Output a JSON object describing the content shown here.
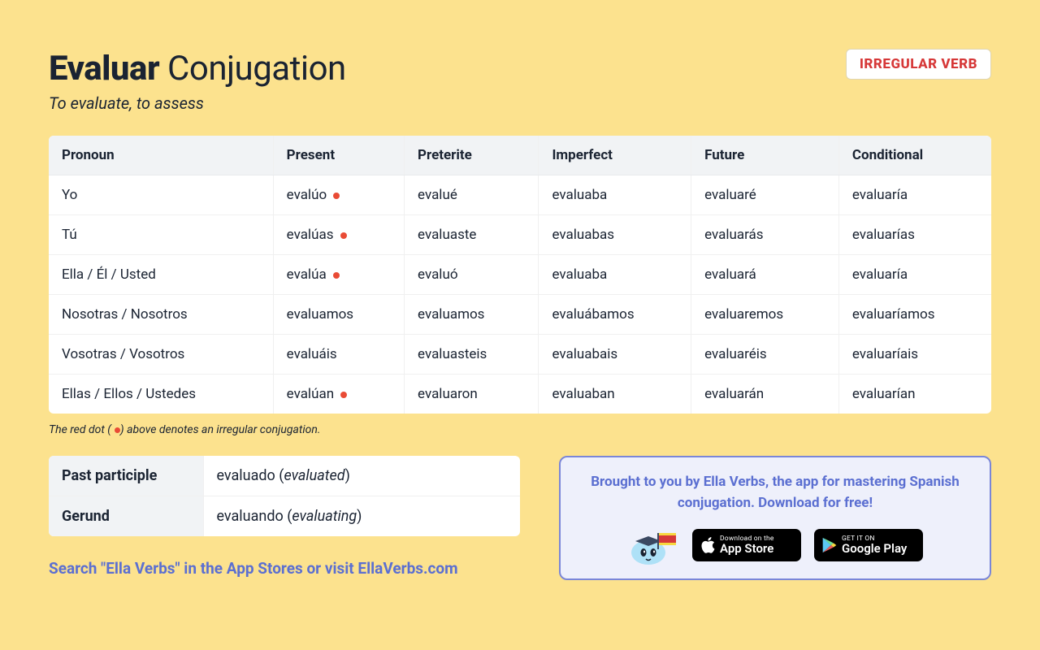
{
  "header": {
    "title_bold": "Evaluar",
    "title_rest": " Conjugation",
    "badge": "IRREGULAR VERB",
    "subtitle": "To evaluate, to assess"
  },
  "table": {
    "headers": [
      "Pronoun",
      "Present",
      "Preterite",
      "Imperfect",
      "Future",
      "Conditional"
    ],
    "rows": [
      {
        "pronoun": "Yo",
        "present": "evalúo",
        "present_irr": true,
        "preterite": "evalué",
        "imperfect": "evaluaba",
        "future": "evaluaré",
        "conditional": "evaluaría"
      },
      {
        "pronoun": "Tú",
        "present": "evalúas",
        "present_irr": true,
        "preterite": "evaluaste",
        "imperfect": "evaluabas",
        "future": "evaluarás",
        "conditional": "evaluarías"
      },
      {
        "pronoun": "Ella / Él / Usted",
        "present": "evalúa",
        "present_irr": true,
        "preterite": "evaluó",
        "imperfect": "evaluaba",
        "future": "evaluará",
        "conditional": "evaluaría"
      },
      {
        "pronoun": "Nosotras / Nosotros",
        "present": "evaluamos",
        "present_irr": false,
        "preterite": "evaluamos",
        "imperfect": "evaluábamos",
        "future": "evaluaremos",
        "conditional": "evaluaríamos"
      },
      {
        "pronoun": "Vosotras / Vosotros",
        "present": "evaluáis",
        "present_irr": false,
        "preterite": "evaluasteis",
        "imperfect": "evaluabais",
        "future": "evaluaréis",
        "conditional": "evaluaríais"
      },
      {
        "pronoun": "Ellas / Ellos / Ustedes",
        "present": "evalúan",
        "present_irr": true,
        "preterite": "evaluaron",
        "imperfect": "evaluaban",
        "future": "evaluarán",
        "conditional": "evaluarían"
      }
    ]
  },
  "footnote": {
    "prefix": "The red dot (",
    "suffix": ") above denotes an irregular conjugation."
  },
  "forms": {
    "past_participle_label": "Past participle",
    "past_participle_value": "evaluado",
    "past_participle_trans": "evaluated",
    "gerund_label": "Gerund",
    "gerund_value": "evaluando",
    "gerund_trans": "evaluating"
  },
  "search_line": "Search \"Ella Verbs\" in the App Stores or visit EllaVerbs.com",
  "promo": {
    "text": "Brought to you by Ella Verbs, the app for mastering Spanish conjugation. Download for free!",
    "appstore_small": "Download on the",
    "appstore_big": "App Store",
    "play_small": "GET IT ON",
    "play_big": "Google Play"
  }
}
